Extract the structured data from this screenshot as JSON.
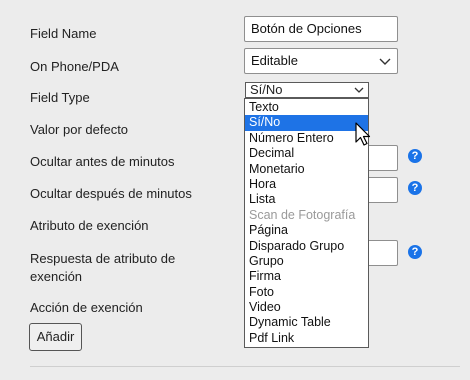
{
  "form": {
    "labels": {
      "field_name": "Field Name",
      "on_phone": "On Phone/PDA",
      "field_type": "Field Type",
      "default_value": "Valor por defecto",
      "hide_before": "Ocultar antes de minutos",
      "hide_after": "Ocultar después de minutos",
      "exemption_attr": "Atributo de exención",
      "exemption_resp": "Respuesta de atributo de exención",
      "exemption_action": "Acción de exención"
    },
    "field_name_value": "Botón de Opciones",
    "on_phone_value": "Editable",
    "field_type_value": "Sí/No",
    "add_button": "Añadir",
    "help_glyph": "?"
  },
  "dropdown": {
    "options": [
      {
        "label": "Texto",
        "state": "normal"
      },
      {
        "label": "Sí/No",
        "state": "selected"
      },
      {
        "label": "Número Entero",
        "state": "normal"
      },
      {
        "label": "Decimal",
        "state": "normal"
      },
      {
        "label": "Monetario",
        "state": "normal"
      },
      {
        "label": "Hora",
        "state": "normal"
      },
      {
        "label": "Lista",
        "state": "normal"
      },
      {
        "label": "Scan de Fotografía",
        "state": "disabled"
      },
      {
        "label": "Página",
        "state": "normal"
      },
      {
        "label": "Disparado Grupo",
        "state": "normal"
      },
      {
        "label": "Grupo",
        "state": "normal"
      },
      {
        "label": "Firma",
        "state": "normal"
      },
      {
        "label": "Foto",
        "state": "normal"
      },
      {
        "label": "Video",
        "state": "normal"
      },
      {
        "label": "Dynamic Table",
        "state": "normal"
      },
      {
        "label": "Pdf Link",
        "state": "normal"
      }
    ]
  },
  "colors": {
    "selected_bg": "#1e73e6",
    "help_icon": "#1a73e8"
  }
}
